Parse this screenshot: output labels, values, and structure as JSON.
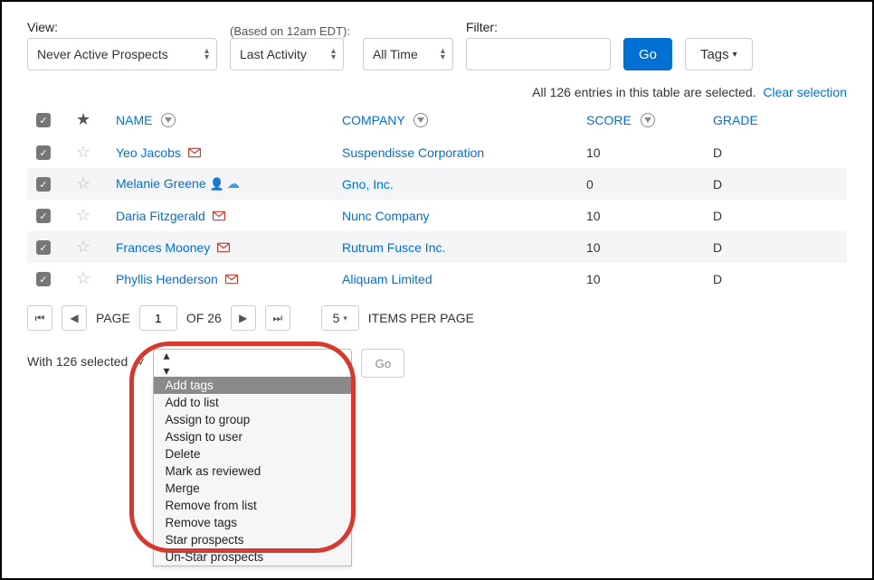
{
  "filters": {
    "view_label": "View:",
    "view_value": "Never Active Prospects",
    "based_note": "(Based on 12am EDT):",
    "activity_value": "Last Activity",
    "range_value": "All Time",
    "filter_label": "Filter:",
    "go_label": "Go",
    "tags_label": "Tags"
  },
  "selection_banner": {
    "text_prefix": "All 126 entries in this table are selected.",
    "clear_label": "Clear selection"
  },
  "columns": {
    "name": "NAME",
    "company": "COMPANY",
    "score": "SCORE",
    "grade": "GRADE"
  },
  "rows": [
    {
      "name": "Yeo Jacobs",
      "company": "Suspendisse Corporation",
      "score": "10",
      "grade": "D",
      "mail": true,
      "sf": false,
      "person": false
    },
    {
      "name": "Melanie Greene",
      "company": "Gno, Inc.",
      "score": "0",
      "grade": "D",
      "mail": false,
      "sf": true,
      "person": true
    },
    {
      "name": "Daria Fitzgerald",
      "company": "Nunc Company",
      "score": "10",
      "grade": "D",
      "mail": true,
      "sf": false,
      "person": false
    },
    {
      "name": "Frances Mooney",
      "company": "Rutrum Fusce Inc.",
      "score": "10",
      "grade": "D",
      "mail": true,
      "sf": false,
      "person": false
    },
    {
      "name": "Phyllis Henderson",
      "company": "Aliquam Limited",
      "score": "10",
      "grade": "D",
      "mail": true,
      "sf": false,
      "person": false
    }
  ],
  "pager": {
    "page_label": "PAGE",
    "page_value": "1",
    "of_label": "OF 26",
    "per_page_value": "5",
    "per_page_label": "ITEMS PER PAGE"
  },
  "action": {
    "with_text": "With 126 selected",
    "selected_option": "Add tags",
    "options": [
      "Add tags",
      "Add to list",
      "Assign to group",
      "Assign to user",
      "Delete",
      "Mark as reviewed",
      "Merge",
      "Remove from list",
      "Remove tags",
      "Star prospects",
      "Un-Star prospects"
    ],
    "go_label": "Go"
  }
}
